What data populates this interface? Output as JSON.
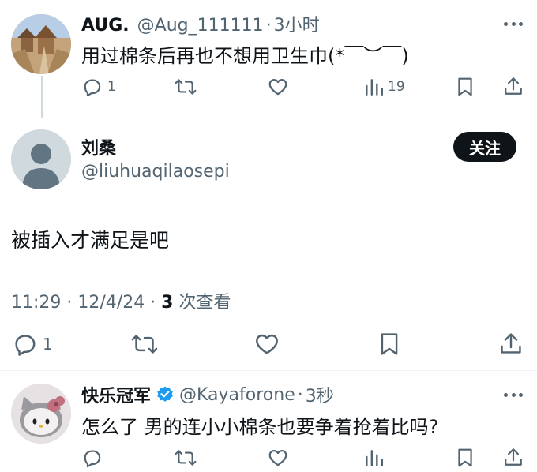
{
  "reply1": {
    "display_name": "AUG.",
    "handle": "@Aug_111111",
    "sep": "·",
    "time": "3小时",
    "text": "用过棉条后再也不想用卫生巾(*￣︶￣)",
    "replies": "1",
    "views": "19"
  },
  "main_tweet": {
    "display_name": "刘桑",
    "handle": "@liuhuaqilaosepi",
    "follow_label": "关注",
    "text": "被插入才满足是吧",
    "timestamp": "11:29 · 12/4/24 · ",
    "view_count": "3",
    "view_label": " 次查看",
    "replies": "1"
  },
  "reply2": {
    "display_name": "快乐冠军",
    "handle": "@Kayaforone",
    "sep": "·",
    "time": "3秒",
    "text": "怎么了 男的连小小棉条也要争着抢着比吗?"
  },
  "colors": {
    "primary_text": "#0f1419",
    "secondary_text": "#536471",
    "verified": "#1d9bf0",
    "follow_bg": "#0f1419"
  }
}
